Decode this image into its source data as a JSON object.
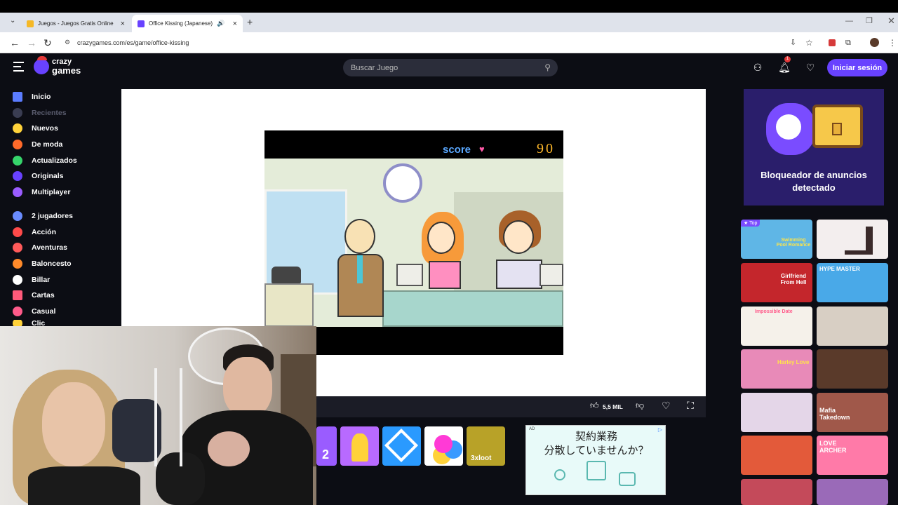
{
  "browser": {
    "tabs": [
      {
        "title": "Juegos - Juegos Gratis Online",
        "active": false
      },
      {
        "title": "Office Kissing (Japanese)",
        "active": true
      }
    ],
    "new_tab": "+",
    "url": "crazygames.com/es/game/office-kissing"
  },
  "site": {
    "logo_top": "crazy",
    "logo_bottom": "games",
    "search_placeholder": "Buscar Juego",
    "notification_count": "1",
    "login_label": "Iniciar sesión"
  },
  "sidebar": {
    "items": [
      {
        "label": "Inicio",
        "color": "#5b7cff"
      },
      {
        "label": "Recientes",
        "color": "#3a3d52",
        "dim": true
      },
      {
        "label": "Nuevos",
        "color": "#ffd23a"
      },
      {
        "label": "De moda",
        "color": "#ff6a2a"
      },
      {
        "label": "Actualizados",
        "color": "#36d46b"
      },
      {
        "label": "Originals",
        "color": "#6842ff"
      },
      {
        "label": "Multiplayer",
        "color": "#9b5cff"
      },
      {
        "label": "2 jugadores",
        "color": "#6a8cff"
      },
      {
        "label": "Acción",
        "color": "#ff4a4a"
      },
      {
        "label": "Aventuras",
        "color": "#ff5a5a"
      },
      {
        "label": "Baloncesto",
        "color": "#ff8a2a"
      },
      {
        "label": "Billar",
        "color": "#ffffff"
      },
      {
        "label": "Cartas",
        "color": "#ff5a7a"
      },
      {
        "label": "Casual",
        "color": "#ff5a8a"
      },
      {
        "label": "Clic",
        "color": "#ffd23a"
      }
    ]
  },
  "game": {
    "score_label": "score",
    "score_value": "90",
    "likes": "5,5 MIL"
  },
  "ads": {
    "blocker_line1": "Bloqueador de anuncios",
    "blocker_line2": "detectado",
    "ad_label": "AD",
    "jp_line1": "契約業務",
    "jp_line2": "分散していませんか？"
  },
  "thumbs": {
    "top_badge": "Top",
    "right_column": [
      {
        "label": "Swimming Pool Romance",
        "color": "#5fb6e6"
      },
      {
        "label": "",
        "color": "#f3eeee"
      },
      {
        "label": "Girlfriend From Hell",
        "color": "#c4262c"
      },
      {
        "label": "HYPE MASTER",
        "color": "#49a9e8"
      },
      {
        "label": "Impossible Date",
        "color": "#f5f1ea"
      },
      {
        "label": "",
        "color": "#d8cfc4"
      },
      {
        "label": "Harley Love",
        "color": "#e88ab8"
      },
      {
        "label": "",
        "color": "#5a3a2a"
      },
      {
        "label": "",
        "color": "#e4d6e8"
      },
      {
        "label": "Mafia Takedown",
        "color": "#a0584a"
      },
      {
        "label": "",
        "color": "#e35a3a"
      },
      {
        "label": "LOVE ARCHER",
        "color": "#ff7aa8"
      },
      {
        "label": "",
        "color": "#c44a5a"
      },
      {
        "label": "",
        "color": "#9a6ab8"
      }
    ],
    "bottom_row": [
      {
        "label": "2",
        "color": "#9a5cff"
      },
      {
        "label": "",
        "color": "#b86aff"
      },
      {
        "label": "",
        "color": "#2a9aff"
      },
      {
        "label": "",
        "color": "#ffffff"
      },
      {
        "label": "3xloot",
        "color": "#b8a228"
      }
    ]
  }
}
